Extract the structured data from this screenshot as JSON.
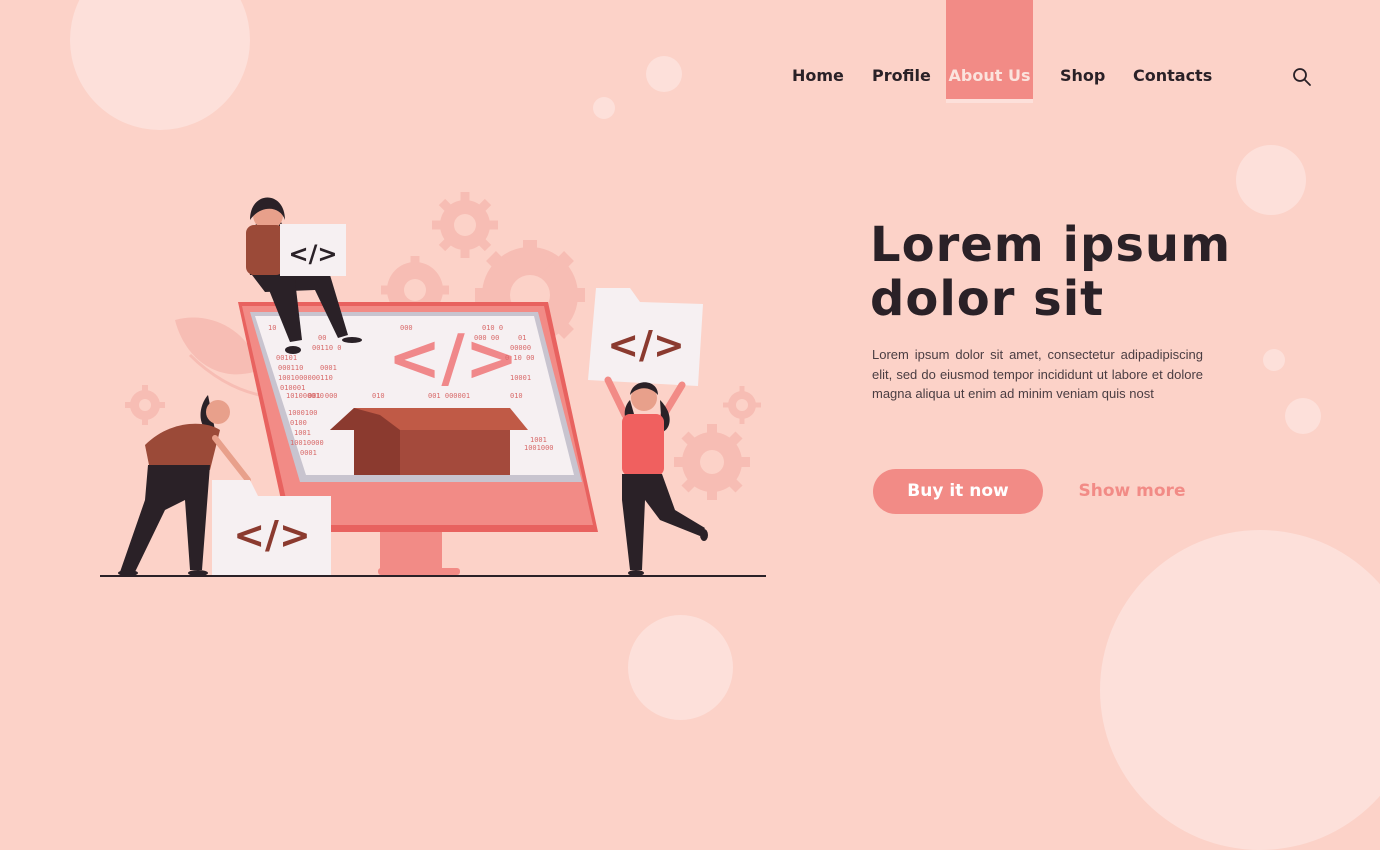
{
  "nav": {
    "items": [
      "Home",
      "Profile",
      "About Us",
      "Shop",
      "Contacts"
    ],
    "active": "About Us",
    "search_icon": "search-icon"
  },
  "hero": {
    "title_line1": "Lorem ipsum",
    "title_line2": "dolor sit",
    "text": "Lorem ipsum dolor sit amet, consectetur adipadipiscing elit, sed do eiusmod tempor incididunt ut labore et dolore magna aliqua ut enim ad minim veniam quis nost",
    "primary_button": "Buy it now",
    "secondary_button": "Show more"
  },
  "illustration": {
    "code_symbol": "</>",
    "screen_binary": [
      "10",
      "00",
      "000",
      "010 0",
      "000 00",
      "01",
      "00110 0",
      "00000",
      "00101",
      "0 10 00",
      "000110",
      "0001",
      "1001000000110",
      "10001",
      "010001",
      "101000010",
      "001 000",
      "010",
      "001 000001",
      "010",
      "1000100",
      "0100",
      "1001",
      "10010000",
      "0001",
      "1001",
      "1001000",
      "00100",
      "10001",
      "100"
    ]
  },
  "colors": {
    "background": "#fcd2c8",
    "accent": "#f28b86",
    "dark_text": "#2a2127",
    "light_circle": "#fde0da",
    "code_red": "#8b3a2f",
    "screen_pink": "#f0888a"
  }
}
